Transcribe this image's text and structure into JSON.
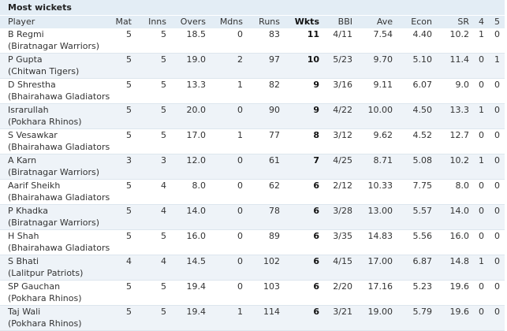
{
  "table": {
    "title": "Most wickets",
    "columns": [
      "Player",
      "Mat",
      "Inns",
      "Overs",
      "Mdns",
      "Runs",
      "Wkts",
      "BBI",
      "Ave",
      "Econ",
      "SR",
      "4",
      "5"
    ],
    "rows": [
      {
        "name": "B Regmi",
        "team": "(Biratnagar Warriors)",
        "mat": "5",
        "inns": "5",
        "overs": "18.5",
        "mdns": "0",
        "runs": "83",
        "wkts": "11",
        "bbi": "4/11",
        "ave": "7.54",
        "econ": "4.40",
        "sr": "10.2",
        "f4": "1",
        "f5": "0"
      },
      {
        "name": "P Gupta",
        "team": "(Chitwan Tigers)",
        "mat": "5",
        "inns": "5",
        "overs": "19.0",
        "mdns": "2",
        "runs": "97",
        "wkts": "10",
        "bbi": "5/23",
        "ave": "9.70",
        "econ": "5.10",
        "sr": "11.4",
        "f4": "0",
        "f5": "1"
      },
      {
        "name": "D Shrestha",
        "team": "(Bhairahawa Gladiators)",
        "mat": "5",
        "inns": "5",
        "overs": "13.3",
        "mdns": "1",
        "runs": "82",
        "wkts": "9",
        "bbi": "3/16",
        "ave": "9.11",
        "econ": "6.07",
        "sr": "9.0",
        "f4": "0",
        "f5": "0"
      },
      {
        "name": "Israrullah",
        "team": "(Pokhara Rhinos)",
        "mat": "5",
        "inns": "5",
        "overs": "20.0",
        "mdns": "0",
        "runs": "90",
        "wkts": "9",
        "bbi": "4/22",
        "ave": "10.00",
        "econ": "4.50",
        "sr": "13.3",
        "f4": "1",
        "f5": "0"
      },
      {
        "name": "S Vesawkar",
        "team": "(Bhairahawa Gladiators)",
        "mat": "5",
        "inns": "5",
        "overs": "17.0",
        "mdns": "1",
        "runs": "77",
        "wkts": "8",
        "bbi": "3/12",
        "ave": "9.62",
        "econ": "4.52",
        "sr": "12.7",
        "f4": "0",
        "f5": "0"
      },
      {
        "name": "A Karn",
        "team": "(Biratnagar Warriors)",
        "mat": "3",
        "inns": "3",
        "overs": "12.0",
        "mdns": "0",
        "runs": "61",
        "wkts": "7",
        "bbi": "4/25",
        "ave": "8.71",
        "econ": "5.08",
        "sr": "10.2",
        "f4": "1",
        "f5": "0"
      },
      {
        "name": "Aarif Sheikh",
        "team": "(Bhairahawa Gladiators)",
        "mat": "5",
        "inns": "4",
        "overs": "8.0",
        "mdns": "0",
        "runs": "62",
        "wkts": "6",
        "bbi": "2/12",
        "ave": "10.33",
        "econ": "7.75",
        "sr": "8.0",
        "f4": "0",
        "f5": "0"
      },
      {
        "name": "P Khadka",
        "team": "(Biratnagar Warriors)",
        "mat": "5",
        "inns": "4",
        "overs": "14.0",
        "mdns": "0",
        "runs": "78",
        "wkts": "6",
        "bbi": "3/28",
        "ave": "13.00",
        "econ": "5.57",
        "sr": "14.0",
        "f4": "0",
        "f5": "0"
      },
      {
        "name": "H Shah",
        "team": "(Bhairahawa Gladiators)",
        "mat": "5",
        "inns": "5",
        "overs": "16.0",
        "mdns": "0",
        "runs": "89",
        "wkts": "6",
        "bbi": "3/35",
        "ave": "14.83",
        "econ": "5.56",
        "sr": "16.0",
        "f4": "0",
        "f5": "0"
      },
      {
        "name": "S Bhati",
        "team": "(Lalitpur Patriots)",
        "mat": "4",
        "inns": "4",
        "overs": "14.5",
        "mdns": "0",
        "runs": "102",
        "wkts": "6",
        "bbi": "4/15",
        "ave": "17.00",
        "econ": "6.87",
        "sr": "14.8",
        "f4": "1",
        "f5": "0"
      },
      {
        "name": "SP Gauchan",
        "team": "(Pokhara Rhinos)",
        "mat": "5",
        "inns": "5",
        "overs": "19.4",
        "mdns": "0",
        "runs": "103",
        "wkts": "6",
        "bbi": "2/20",
        "ave": "17.16",
        "econ": "5.23",
        "sr": "19.6",
        "f4": "0",
        "f5": "0"
      },
      {
        "name": "Taj Wali",
        "team": "(Pokhara Rhinos)",
        "mat": "5",
        "inns": "5",
        "overs": "19.4",
        "mdns": "1",
        "runs": "114",
        "wkts": "6",
        "bbi": "3/21",
        "ave": "19.00",
        "econ": "5.79",
        "sr": "19.6",
        "f4": "0",
        "f5": "0"
      }
    ]
  }
}
